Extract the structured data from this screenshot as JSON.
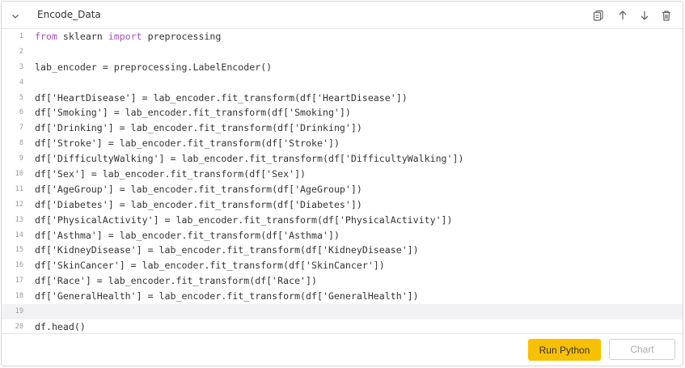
{
  "cell": {
    "title": "Encode_Data",
    "icons": [
      "chevron-down-icon",
      "copy-icon",
      "arrow-up-icon",
      "arrow-down-icon",
      "trash-icon"
    ],
    "active_line": 19
  },
  "code": {
    "lines": [
      {
        "n": "1",
        "segments": [
          {
            "t": "from",
            "c": "#a94fc8"
          },
          {
            "t": " sklearn ",
            "c": "#333333"
          },
          {
            "t": "import",
            "c": "#a94fc8"
          },
          {
            "t": " preprocessing",
            "c": "#333333"
          }
        ]
      },
      {
        "n": "2",
        "text": ""
      },
      {
        "n": "3",
        "text": "lab_encoder = preprocessing.LabelEncoder()"
      },
      {
        "n": "4",
        "text": ""
      },
      {
        "n": "5",
        "text": "df['HeartDisease'] = lab_encoder.fit_transform(df['HeartDisease'])"
      },
      {
        "n": "6",
        "text": "df['Smoking'] = lab_encoder.fit_transform(df['Smoking'])"
      },
      {
        "n": "7",
        "text": "df['Drinking'] = lab_encoder.fit_transform(df['Drinking'])"
      },
      {
        "n": "8",
        "text": "df['Stroke'] = lab_encoder.fit_transform(df['Stroke'])"
      },
      {
        "n": "9",
        "text": "df['DifficultyWalking'] = lab_encoder.fit_transform(df['DifficultyWalking'])"
      },
      {
        "n": "10",
        "text": "df['Sex'] = lab_encoder.fit_transform(df['Sex'])"
      },
      {
        "n": "11",
        "text": "df['AgeGroup'] = lab_encoder.fit_transform(df['AgeGroup'])"
      },
      {
        "n": "12",
        "text": "df['Diabetes'] = lab_encoder.fit_transform(df['Diabetes'])"
      },
      {
        "n": "13",
        "text": "df['PhysicalActivity'] = lab_encoder.fit_transform(df['PhysicalActivity'])"
      },
      {
        "n": "14",
        "text": "df['Asthma'] = lab_encoder.fit_transform(df['Asthma'])"
      },
      {
        "n": "15",
        "text": "df['KidneyDisease'] = lab_encoder.fit_transform(df['KidneyDisease'])"
      },
      {
        "n": "16",
        "text": "df['SkinCancer'] = lab_encoder.fit_transform(df['SkinCancer'])"
      },
      {
        "n": "17",
        "text": "df['Race'] = lab_encoder.fit_transform(df['Race'])"
      },
      {
        "n": "18",
        "text": "df['GeneralHealth'] = lab_encoder.fit_transform(df['GeneralHealth'])"
      },
      {
        "n": "19",
        "text": ""
      },
      {
        "n": "20",
        "text": "df.head()"
      }
    ]
  },
  "footer": {
    "run_label": "Run Python",
    "chart_label": "Chart",
    "run_color": "#f7c000"
  }
}
